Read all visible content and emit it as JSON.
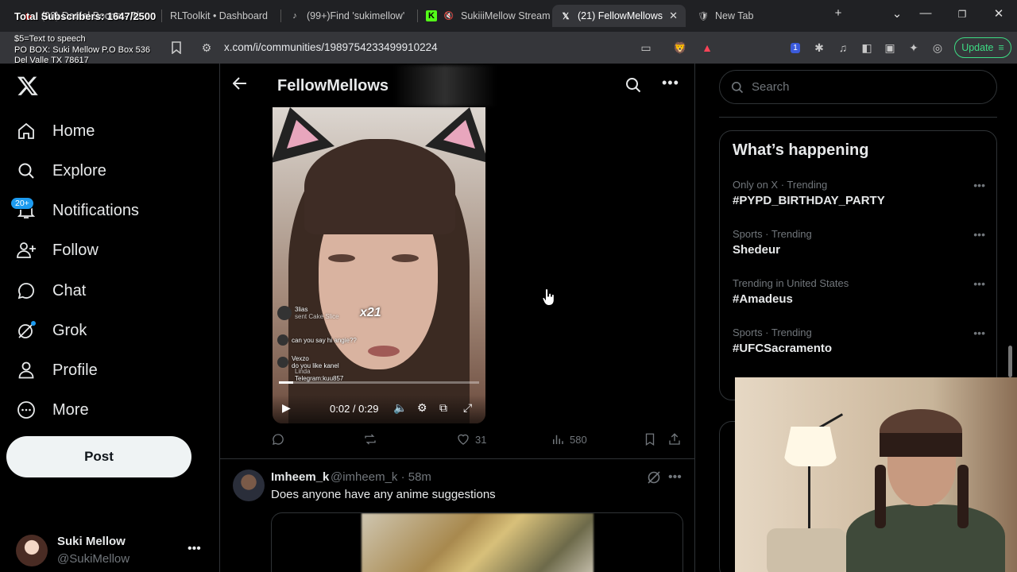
{
  "overlay": {
    "subscribers": "Total Subscribers: 1647/2500",
    "tts_line1": "$5=Text to speech",
    "tts_line2": "PO BOX: Suki Mellow P.O Box 536",
    "tts_line3": "Del Valle TX 78617"
  },
  "browser": {
    "tabs": [
      {
        "label": "(90) Daniel Boone - Pi",
        "icon": "youtube-icon"
      },
      {
        "label": "RLToolkit • Dashboard",
        "icon": "page-icon"
      },
      {
        "label": "(99+)Find 'sukimellow'",
        "icon": "tiktok-icon"
      },
      {
        "label": "SukiiiMellow Stream",
        "icon": "kick-icon"
      },
      {
        "label": "(21) FellowMellows",
        "icon": "x-icon"
      },
      {
        "label": "New Tab",
        "icon": "brave-icon"
      }
    ],
    "url": "x.com/i/communities/1989754233499910224",
    "update_label": "Update",
    "extension_badge": "1"
  },
  "sidebar": {
    "nav": [
      {
        "label": "Home",
        "icon": "home-icon"
      },
      {
        "label": "Explore",
        "icon": "search-icon"
      },
      {
        "label": "Notifications",
        "icon": "bell-icon"
      },
      {
        "label": "Follow",
        "icon": "follow-icon"
      },
      {
        "label": "Chat",
        "icon": "chat-icon"
      },
      {
        "label": "Grok",
        "icon": "grok-icon"
      },
      {
        "label": "Profile",
        "icon": "profile-icon"
      },
      {
        "label": "More",
        "icon": "more-circle-icon"
      }
    ],
    "notifications_badge": "20+",
    "post_label": "Post",
    "account": {
      "name": "Suki Mellow",
      "handle": "@SukiMellow"
    }
  },
  "main": {
    "title": "FellowMellows",
    "video": {
      "time": "0:02 / 0:29",
      "progress_fraction": 0.07,
      "gift_count": "x21",
      "chat": [
        {
          "user": "3lias",
          "text": "sent Cake Slice"
        },
        {
          "user": "",
          "text": "can you say hi angie??"
        },
        {
          "user": "Vexzo",
          "text": "do you like kanel"
        },
        {
          "user": "Linda",
          "text": "Telegram:kuu857"
        }
      ]
    },
    "post1_actions": {
      "replies": "",
      "reposts": "",
      "likes": "31",
      "views": "580"
    },
    "post2": {
      "name": "Imheem_k",
      "handle": "@imheem_k · 58m",
      "text": "Does anyone have any anime suggestions"
    }
  },
  "right": {
    "search_placeholder": "Search",
    "trends_title": "What’s happening",
    "trends": [
      {
        "meta": "Only on X · Trending",
        "name": "#PYPD_BIRTHDAY_PARTY"
      },
      {
        "meta": "Sports · Trending",
        "name": "Shedeur"
      },
      {
        "meta": "Trending in United States",
        "name": "#Amadeus"
      },
      {
        "meta": "Sports · Trending",
        "name": "#UFCSacramento"
      }
    ]
  }
}
